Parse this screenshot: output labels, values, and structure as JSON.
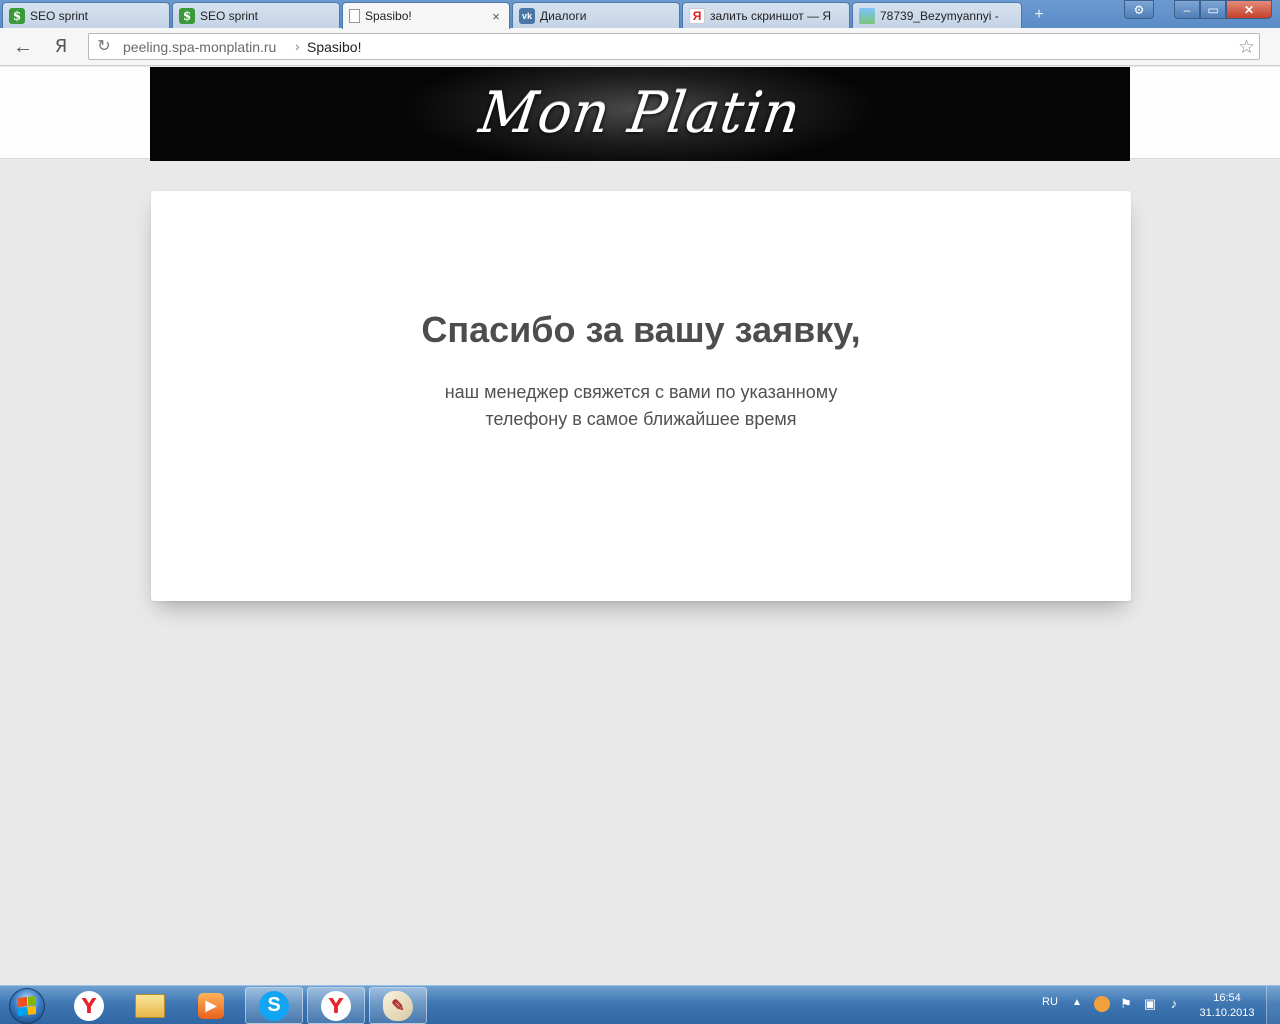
{
  "browser": {
    "tabs": [
      {
        "title": "SEO sprint",
        "favicon": "seosprint-icon"
      },
      {
        "title": "SEO sprint",
        "favicon": "seosprint-icon"
      },
      {
        "title": "Spasibo!",
        "favicon": "page-icon",
        "close": "×"
      },
      {
        "title": "Диалоги",
        "favicon": "vk-icon"
      },
      {
        "title": "залить скриншот — Я",
        "favicon": "yandex-icon"
      },
      {
        "title": "78739_Bezymyannyi - ",
        "favicon": "image-icon"
      }
    ],
    "window_controls": {
      "settings": "⚙",
      "minimize": "–",
      "maximize": "▭",
      "close": "✕"
    },
    "toolbar": {
      "back": "←",
      "yandex": "Я",
      "reload": "↻"
    },
    "address": {
      "host": "peeling.spa-monplatin.ru",
      "separator": "›",
      "page_title": "Spasibo!"
    },
    "star": "☆",
    "newtab": "+"
  },
  "page": {
    "logo": "Mon Platin",
    "heading": "Спасибо за вашу заявку,",
    "message_line1": "наш менеджер свяжется с вами по указанному",
    "message_line2": "телефону в самое ближайшее время"
  },
  "taskbar": {
    "apps": [
      {
        "name": "yandex-browser",
        "glyph": "Y"
      },
      {
        "name": "explorer",
        "glyph": ""
      },
      {
        "name": "media-player",
        "glyph": "▶"
      },
      {
        "name": "skype",
        "glyph": "S"
      },
      {
        "name": "yandex-browser-active",
        "glyph": "Y"
      },
      {
        "name": "paint",
        "glyph": "✎"
      }
    ],
    "lang": "RU",
    "tray_arrow": "▲",
    "time": "16:54",
    "date": "31.10.2013"
  },
  "colors": {
    "tabstrip": "#5b8bc6",
    "page_bg": "#e9e9e9",
    "heading": "#4d4d4d",
    "close_button": "#c4412a"
  }
}
